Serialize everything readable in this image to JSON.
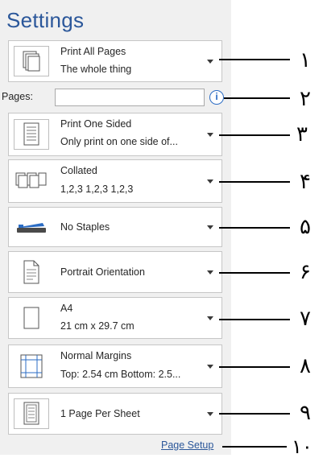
{
  "title": "Settings",
  "dropdowns": [
    {
      "line1": "Print All Pages",
      "line2": "The whole thing",
      "icon": "pages-stack-icon"
    },
    {
      "line1": "Print One Sided",
      "line2": "Only print on one side of...",
      "icon": "one-sided-page-icon"
    },
    {
      "line1": "Collated",
      "line2": "1,2,3   1,2,3   1,2,3",
      "icon": "collated-pages-icon"
    },
    {
      "line1": "No Staples",
      "line2": "",
      "icon": "stapler-icon"
    },
    {
      "line1": "Portrait Orientation",
      "line2": "",
      "icon": "portrait-page-icon"
    },
    {
      "line1": "A4",
      "line2": "21 cm x 29.7 cm",
      "icon": "paper-size-icon"
    },
    {
      "line1": "Normal Margins",
      "line2": "Top: 2.54 cm Bottom: 2.5...",
      "icon": "margins-icon"
    },
    {
      "line1": "1 Page Per Sheet",
      "line2": "",
      "icon": "page-per-sheet-icon"
    }
  ],
  "pages": {
    "label": "Pages:",
    "value": "",
    "info_glyph": "i"
  },
  "page_setup_link": "Page Setup",
  "callouts": [
    "١",
    "٢",
    "٣",
    "۴",
    "۵",
    "۶",
    "٧",
    "٨",
    "٩",
    "١٠"
  ],
  "colors": {
    "accent": "#2b579a",
    "panel_bg": "#f0f0f0"
  }
}
